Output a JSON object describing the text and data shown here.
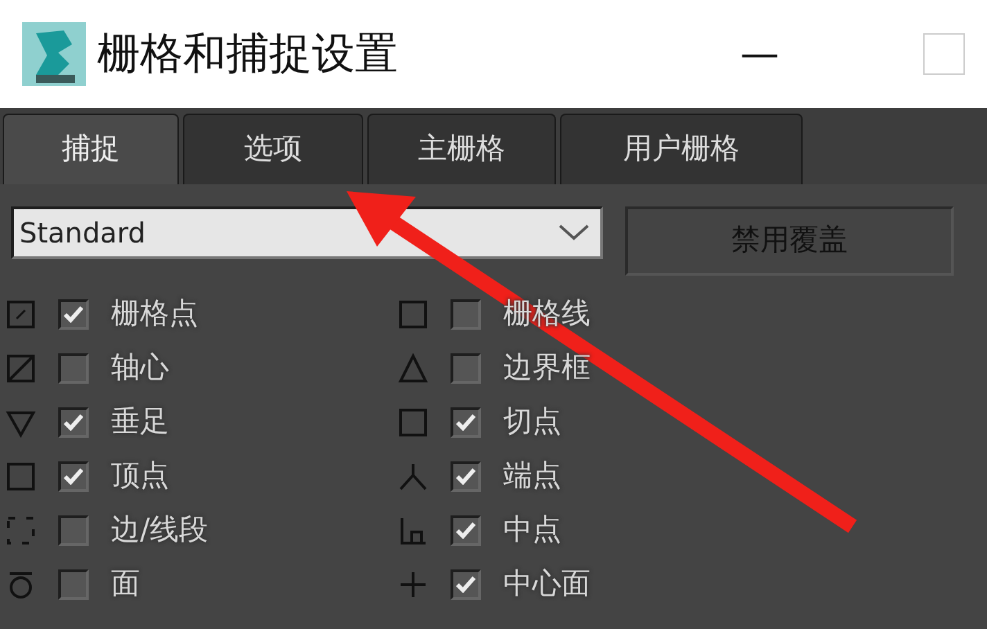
{
  "window": {
    "title": "栅格和捕捉设置",
    "minimize": "—"
  },
  "tabs": [
    {
      "label": "捕捉",
      "selected": true
    },
    {
      "label": "选项",
      "selected": false
    },
    {
      "label": "主栅格",
      "selected": false
    },
    {
      "label": "用户栅格",
      "selected": false
    }
  ],
  "dropdown": {
    "value": "Standard"
  },
  "override_button": "禁用覆盖",
  "snaps": [
    [
      {
        "kind": "grid-point",
        "label": "栅格点",
        "checked": true
      },
      {
        "kind": "pivot",
        "label": "轴心",
        "checked": false
      },
      {
        "kind": "perpendicular",
        "label": "垂足",
        "checked": true
      },
      {
        "kind": "vertex",
        "label": "顶点",
        "checked": true
      },
      {
        "kind": "edge",
        "label": "边/线段",
        "checked": false
      },
      {
        "kind": "face",
        "label": "面",
        "checked": false
      }
    ],
    [
      {
        "kind": "grid-line",
        "label": "栅格线",
        "checked": false
      },
      {
        "kind": "bounding-box",
        "label": "边界框",
        "checked": false
      },
      {
        "kind": "tangent",
        "label": "切点",
        "checked": true
      },
      {
        "kind": "endpoint",
        "label": "端点",
        "checked": true
      },
      {
        "kind": "midpoint",
        "label": "中点",
        "checked": true
      },
      {
        "kind": "center-face",
        "label": "中心面",
        "checked": true
      }
    ]
  ],
  "annotations": [
    {
      "kind": "arrow"
    }
  ]
}
